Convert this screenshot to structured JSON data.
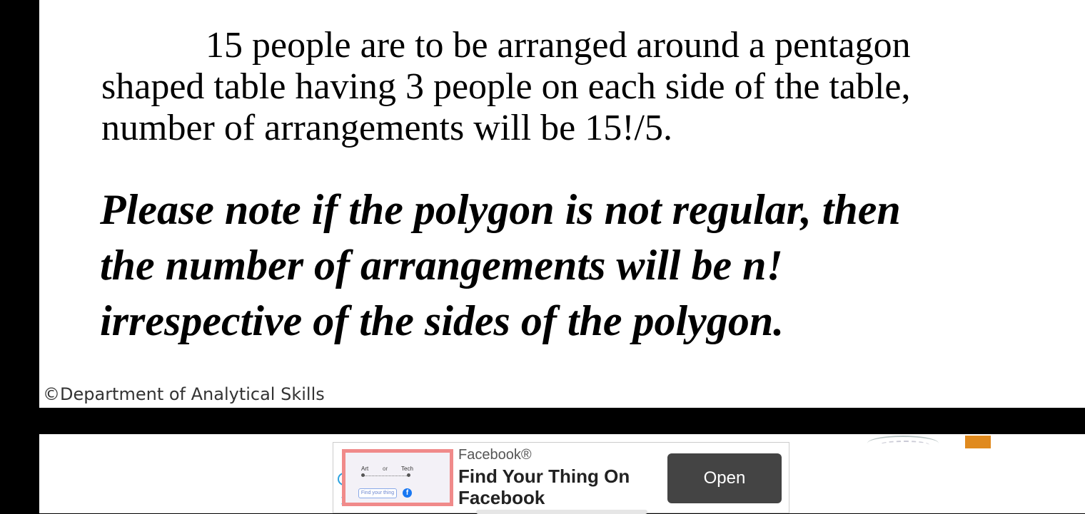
{
  "slide": {
    "paragraph_lines": [
      "15 people are to be arranged around a pentagon",
      "shaped table having 3 people on each side of the table,",
      "number of arrangements will be 15!/5."
    ],
    "note_lines": [
      "Please note if the polygon is not regular, then",
      "the number of arrangements will be n!",
      "irrespective of the sides of the polygon."
    ],
    "copyright": "©Department of Analytical Skills"
  },
  "ad": {
    "brand": "Facebook®",
    "headline": "Find Your Thing On Facebook",
    "open_label": "Open",
    "info_icon": "info-icon",
    "close_icon": "close-icon",
    "thumbnail": {
      "left_label": "Art",
      "middle_label": "or",
      "right_label": "Tech",
      "pill_text": "Find your thing",
      "badge_icon": "facebook-logo-icon"
    },
    "accent_color": "#2ba3e0",
    "button_color": "#444444"
  }
}
